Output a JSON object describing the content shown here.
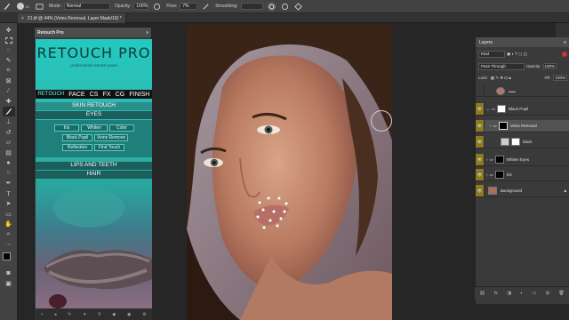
{
  "options_bar": {
    "mode_label": "Mode:",
    "mode_value": "Normal",
    "opacity_label": "Opacity:",
    "opacity_value": "100%",
    "flow_label": "Flow:",
    "flow_value": "7%",
    "smoothing_label": "Smoothing:",
    "smoothing_value": "",
    "brush_size": "12"
  },
  "document_tab": {
    "title": "21.tif @ 44% (Veins Removal, Layer Mask/16) *",
    "close": "×"
  },
  "retouch_panel": {
    "title": "Retouch Pro",
    "collapse": "»",
    "logo": "RETOUCH PRO",
    "subtitle": "professional retouch panel",
    "nav": [
      "RETOUCH",
      "FACE",
      "CS",
      "FX",
      "CG",
      "FINISH"
    ],
    "sections": {
      "skin": "SKIN RETOUCH",
      "eyes": "EYES",
      "lips": "LIPS AND TEETH",
      "hair": "HAIR"
    },
    "eye_buttons": [
      "Iris",
      "Whiten",
      "Color",
      "Black Pupil",
      "Veins Remove",
      "Reflection",
      "Find Touch"
    ]
  },
  "layers_panel": {
    "title": "Layers",
    "menu": "≡",
    "filter_value": "Kind",
    "blend_value": "Pass Through",
    "opacity_label": "Opacity:",
    "opacity_value": "100%",
    "lock_label": "Lock:",
    "fill_label": "Fill:",
    "fill_value": "100%",
    "layers": [
      {
        "name": "",
        "visible": false
      },
      {
        "name": "Black Pupil",
        "visible": true
      },
      {
        "name": "Veins Removal",
        "visible": true
      },
      {
        "name": "black",
        "visible": true
      },
      {
        "name": "Whiten Eyes",
        "visible": true
      },
      {
        "name": "Iris",
        "visible": true
      },
      {
        "name": "Background",
        "visible": true
      }
    ]
  },
  "colors": {
    "accent_teal": "#24c9c0",
    "eye_gold": "#8b7a21"
  }
}
